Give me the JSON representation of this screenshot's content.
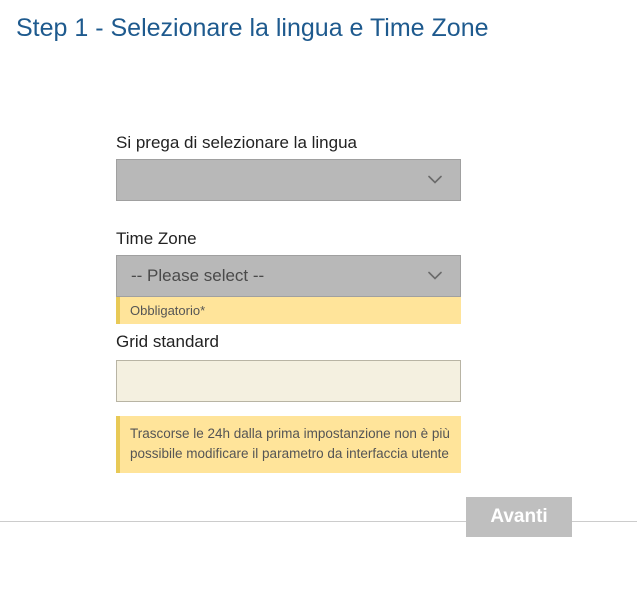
{
  "title": "Step 1 - Selezionare la lingua e Time Zone",
  "language": {
    "label": "Si prega di selezionare la lingua",
    "value": ""
  },
  "timezone": {
    "label": "Time Zone",
    "value": "-- Please select --",
    "required_note": "Obbligatorio*"
  },
  "grid": {
    "label": "Grid standard",
    "value": "",
    "info_note": "Trascorse le 24h dalla prima impostanzione non è più possibile modificare il parametro da interfaccia utente"
  },
  "buttons": {
    "next": "Avanti"
  },
  "icons": {
    "chevron_down": "chevron"
  },
  "colors": {
    "accent": "#1e5a8e",
    "warning_bg": "#ffe49a",
    "warning_border": "#e8c956",
    "select_bg": "#b8b8b8"
  }
}
